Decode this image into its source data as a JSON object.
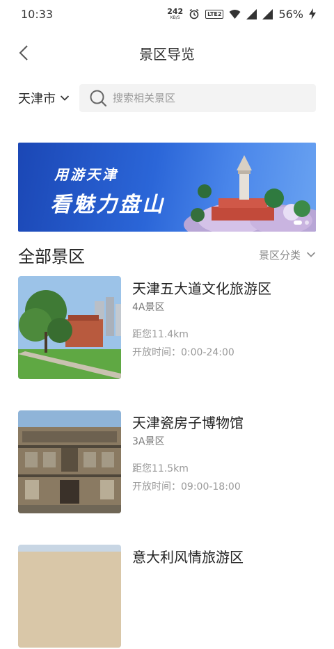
{
  "status_bar": {
    "time": "10:33",
    "net_speed_value": "242",
    "net_speed_unit": "KB/S",
    "volte_label": "LTE2",
    "battery_percent": "56%"
  },
  "header": {
    "title": "景区导览"
  },
  "search": {
    "city": "天津市",
    "placeholder": "搜索相关景区"
  },
  "banner": {
    "line1": "用游天津",
    "line2": "看魅力盘山",
    "slide_count": 2,
    "active_slide": 1
  },
  "section": {
    "title": "全部景区",
    "filter_label": "景区分类"
  },
  "scenic_spots": [
    {
      "name": "天津五大道文化旅游区",
      "level": "4A景区",
      "distance": "距您11.4km",
      "hours": "开放时间：0:00-24:00"
    },
    {
      "name": "天津瓷房子博物馆",
      "level": "3A景区",
      "distance": "距您11.5km",
      "hours": "开放时间：09:00-18:00"
    },
    {
      "name": "意大利风情旅游区",
      "level": "",
      "distance": "",
      "hours": ""
    }
  ],
  "colors": {
    "banner_blue": "#1b47b5",
    "accent": "#222222",
    "muted": "#999999"
  }
}
